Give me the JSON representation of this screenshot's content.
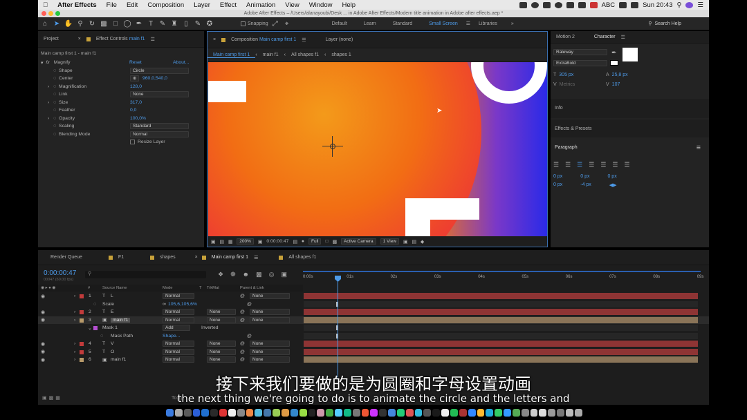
{
  "menubar": {
    "app": "After Effects",
    "items": [
      "File",
      "Edit",
      "Composition",
      "Layer",
      "Effect",
      "Animation",
      "View",
      "Window",
      "Help"
    ],
    "clock": "Sun 20:43",
    "input": "ABC"
  },
  "window": {
    "title": "Adobe After Effects – /Users/alanayoubi/Desk ...   in Adobe After Effects/Modern title animation in Adobe after effects.aep *"
  },
  "toolbar": {
    "snapping": "Snapping",
    "workspaces": [
      "Default",
      "Learn",
      "Standard",
      "Small Screen"
    ],
    "active_workspace": "Small Screen",
    "libraries": "Libraries",
    "search_placeholder": "Search Help"
  },
  "project": {
    "tab": "Project",
    "fx_tab": "Effect Controls",
    "fx_tab_layer": "main f1",
    "breadcrumb": "Main camp first 1 - main f1",
    "effect": "Magnify",
    "reset": "Reset",
    "about": "About...",
    "props": [
      {
        "name": "Shape",
        "value": "Circle",
        "kind": "select"
      },
      {
        "name": "Center",
        "value": "960,0,540,0",
        "kind": "point"
      },
      {
        "name": "Magnification",
        "value": "128,0",
        "kind": "num"
      },
      {
        "name": "Link",
        "value": "None",
        "kind": "select"
      },
      {
        "name": "Size",
        "value": "317,0",
        "kind": "num"
      },
      {
        "name": "Feather",
        "value": "0,0",
        "kind": "num"
      },
      {
        "name": "Opacity",
        "value": "100,0%",
        "kind": "num"
      },
      {
        "name": "Scaling",
        "value": "Standard",
        "kind": "select"
      },
      {
        "name": "Blending Mode",
        "value": "Normal",
        "kind": "select"
      }
    ],
    "resize": "Resize Layer"
  },
  "comp": {
    "tab": "Composition",
    "tab_name": "Main camp first 1",
    "layer_tab": "Layer (none)",
    "crumbs": [
      "Main camp first 1",
      "main f1",
      "All shapes f1",
      "shapes 1"
    ],
    "footer": {
      "zoom": "200%",
      "time": "0:00:00:47",
      "res": "Full",
      "camera": "Active Camera",
      "views": "1 View"
    }
  },
  "right": {
    "tabs": [
      "Motion 2",
      "Character"
    ],
    "font": "Raleway",
    "style": "ExtraBold",
    "size": "305 px",
    "leading": "25,8 px",
    "kerning": "Metrics",
    "tracking": "107",
    "info": "Info",
    "effects": "Effects & Presets",
    "paragraph": "Paragraph",
    "para_vals": [
      "0 px",
      "0 px",
      "0 px",
      "0 px",
      "-4 px"
    ]
  },
  "timeline": {
    "tabs": [
      "Render Queue",
      "F1",
      "shapes",
      "Main camp first 1",
      "All shapes f1"
    ],
    "active_tab": "Main camp first 1",
    "timecode": "0:00:00:47",
    "fps": "00047 (60.00 fps)",
    "cols": [
      "#",
      "Source Name",
      "Mode",
      "T",
      "TrkMat",
      "Parent & Link"
    ],
    "ruler": [
      "0:00s",
      "01s",
      "02s",
      "03s",
      "04s",
      "05s",
      "06s",
      "07s",
      "08s",
      "09s"
    ],
    "rows": [
      {
        "num": "1",
        "type": "T",
        "name": "L",
        "mode": "Normal",
        "trk": "",
        "parent": "None",
        "color": "#c23b3b"
      },
      {
        "num": "",
        "type": "",
        "name": "Scale",
        "mode": "",
        "trk": "",
        "parent": "",
        "value": "105,6,105,6%",
        "color": ""
      },
      {
        "num": "2",
        "type": "T",
        "name": "E",
        "mode": "Normal",
        "trk": "None",
        "parent": "None",
        "color": "#c23b3b"
      },
      {
        "num": "3",
        "type": "img",
        "name": "main f1",
        "mode": "Normal",
        "trk": "None",
        "parent": "None",
        "color": "#b89a6a"
      },
      {
        "num": "",
        "type": "",
        "name": "Mask 1",
        "mode": "Add",
        "trk": "Inverted",
        "parent": "",
        "color": ""
      },
      {
        "num": "",
        "type": "",
        "name": "Mask Path",
        "mode": "Shape...",
        "trk": "",
        "parent": "",
        "color": ""
      },
      {
        "num": "4",
        "type": "T",
        "name": "V",
        "mode": "Normal",
        "trk": "None",
        "parent": "None",
        "color": "#c23b3b"
      },
      {
        "num": "5",
        "type": "T",
        "name": "O",
        "mode": "Normal",
        "trk": "None",
        "parent": "None",
        "color": "#c23b3b"
      },
      {
        "num": "6",
        "type": "img",
        "name": "main f1",
        "mode": "Normal",
        "trk": "None",
        "parent": "None",
        "color": "#b89a6a"
      }
    ],
    "footer_label": "Togg"
  },
  "subtitle": {
    "cn": "接下来我们要做的是为圆圈和字母设置动画",
    "en": "the next thing we're going to do is to animate the circle and the letters and"
  }
}
